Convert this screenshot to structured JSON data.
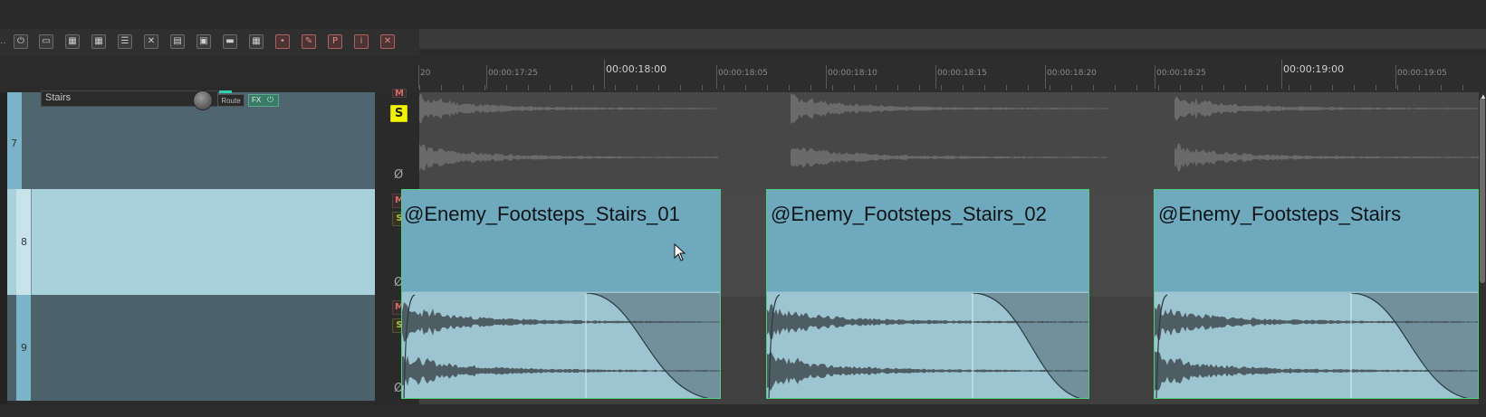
{
  "toolbar": {
    "buttons": [
      {
        "name": "power-icon",
        "glyph": "⏻",
        "style": "normal"
      },
      {
        "name": "folder-icon",
        "glyph": "▭",
        "style": "normal"
      },
      {
        "name": "grid-icon",
        "glyph": "▦",
        "style": "normal"
      },
      {
        "name": "grid-snap-icon",
        "glyph": "▦",
        "style": "normal"
      },
      {
        "name": "list-icon",
        "glyph": "☰",
        "style": "normal"
      },
      {
        "name": "crossfade-icon",
        "glyph": "✕",
        "style": "normal"
      },
      {
        "name": "ripple-icon",
        "glyph": "▤",
        "style": "normal"
      },
      {
        "name": "lock-icon",
        "glyph": "▣",
        "style": "normal"
      },
      {
        "name": "envelope-icon",
        "glyph": "▬",
        "style": "normal"
      },
      {
        "name": "region-icon",
        "glyph": "▦",
        "style": "normal"
      },
      {
        "name": "marker-icon",
        "glyph": "•",
        "style": "red"
      },
      {
        "name": "pencil-icon",
        "glyph": "✎",
        "style": "red"
      },
      {
        "name": "p-icon",
        "glyph": "P",
        "style": "red"
      },
      {
        "name": "info-icon",
        "glyph": "i",
        "style": "red"
      },
      {
        "name": "close-icon",
        "glyph": "✕",
        "style": "red"
      }
    ]
  },
  "ruler": {
    "labels": [
      {
        "text": "20",
        "major": false
      },
      {
        "text": "00:00:17:25",
        "major": false
      },
      {
        "text": "00:00:18:00",
        "major": true
      },
      {
        "text": "00:00:18:05",
        "major": false
      },
      {
        "text": "00:00:18:10",
        "major": false
      },
      {
        "text": "00:00:18:15",
        "major": false
      },
      {
        "text": "00:00:18:20",
        "major": false
      },
      {
        "text": "00:00:18:25",
        "major": false
      },
      {
        "text": "00:00:19:00",
        "major": true
      },
      {
        "text": "00:00:19:05",
        "major": false
      }
    ]
  },
  "tracks": {
    "t7": {
      "number": "7",
      "name": "Stairs",
      "route_label": "Route",
      "fx_label": "FX",
      "mute": "M",
      "solo": "S",
      "phase": "Ø"
    },
    "t8": {
      "number": "8",
      "mute": "M",
      "solo": "S",
      "phase": "Ø"
    },
    "t9": {
      "number": "9",
      "mute": "M",
      "solo": "S",
      "phase": "Ø"
    }
  },
  "items": [
    {
      "label": "@Enemy_Footsteps_Stairs_01"
    },
    {
      "label": "@Enemy_Footsteps_Stairs_02"
    },
    {
      "label": "@Enemy_Footsteps_Stairs"
    }
  ],
  "colors": {
    "track7": "#4f6670",
    "track8": "#a9d1dc",
    "track9": "#4d636c",
    "item_top": "#6fa9bd",
    "item_bottom": "#9dc5d1",
    "solo_active": "#f2f200"
  }
}
